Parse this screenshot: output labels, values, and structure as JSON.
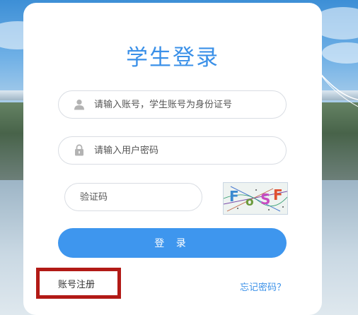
{
  "login": {
    "title": "学生登录",
    "username_placeholder": "请输入账号，学生账号为身份证号",
    "password_placeholder": "请输入用户密码",
    "captcha_placeholder": "验证码",
    "captcha_chars": [
      "F",
      "o",
      "S",
      "F"
    ],
    "login_button": "登 录",
    "register_link": "账号注册",
    "forgot_link": "忘记密码？"
  },
  "colors": {
    "accent": "#3a90e8",
    "button": "#3e96ee",
    "highlight_border": "#b21a16"
  },
  "icons": {
    "username": "user-icon",
    "password": "lock-icon"
  }
}
